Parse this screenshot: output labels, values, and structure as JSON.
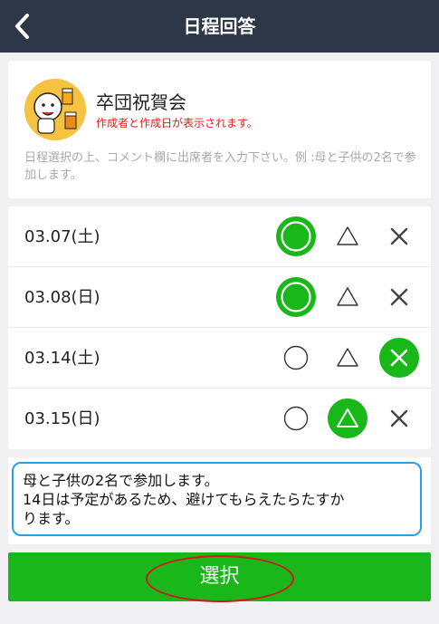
{
  "header": {
    "title": "日程回答",
    "back_icon": "chevron-left-icon"
  },
  "event": {
    "title": "卒団祝賀会",
    "note": "作成者と作成日が表示されます。",
    "description": "日程選択の上、コメント欄に出席者を入力下さい。例 :母と子供の2名で参加します。",
    "avatar_icon": "character-with-beer-avatar"
  },
  "dates": [
    {
      "date": "03.07(土)",
      "selected": "circle"
    },
    {
      "date": "03.08(日)",
      "selected": "circle"
    },
    {
      "date": "03.14(土)",
      "selected": "cross"
    },
    {
      "date": "03.15(日)",
      "selected": "triangle"
    }
  ],
  "comment": {
    "line1": "母と子供の2名で参加します。",
    "line2": "14日は予定があるため、避けてもらえたらたすか",
    "line3": "ります。"
  },
  "button": {
    "label": "選択"
  },
  "colors": {
    "header_bg": "#2e3747",
    "accent_green": "#1ab71a",
    "comment_border": "#29a0e0",
    "note_red": "#e02020",
    "annotation_red": "#d21a1a"
  }
}
